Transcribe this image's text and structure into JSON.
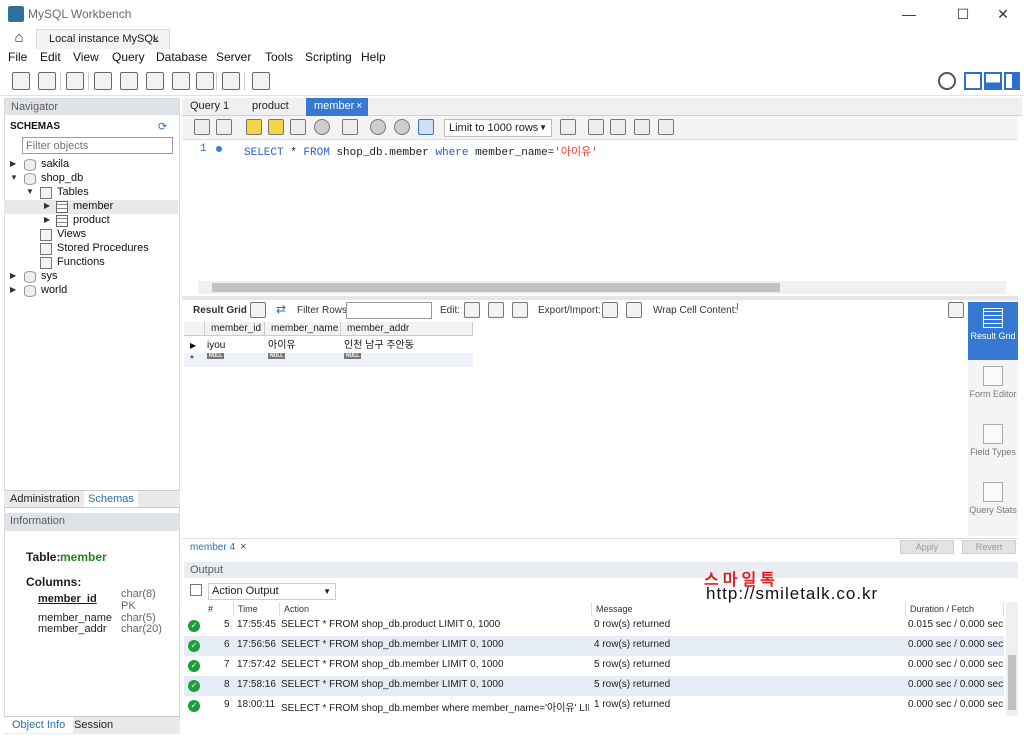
{
  "window": {
    "title": "MySQL Workbench",
    "minimize": "—",
    "maximize": "☐",
    "close": "✕"
  },
  "connection_tab": {
    "label": "Local instance MySQL",
    "close": "×"
  },
  "menu": [
    "File",
    "Edit",
    "View",
    "Query",
    "Database",
    "Server",
    "Tools",
    "Scripting",
    "Help"
  ],
  "navigator": {
    "header": "Navigator",
    "schemas_label": "SCHEMAS",
    "filter_placeholder": "Filter objects",
    "tree": {
      "sakila": "sakila",
      "shop_db": "shop_db",
      "tables": "Tables",
      "member": "member",
      "product": "product",
      "views": "Views",
      "procedures": "Stored Procedures",
      "functions": "Functions",
      "sys": "sys",
      "world": "world"
    },
    "tabs": [
      "Administration",
      "Schemas"
    ]
  },
  "information": {
    "header": "Information",
    "table_label": "Table:",
    "table_name": "member",
    "columns_label": "Columns:",
    "columns": [
      {
        "name": "member_id",
        "type": "char(8)",
        "extra": "PK"
      },
      {
        "name": "member_name",
        "type": "char(5)"
      },
      {
        "name": "member_addr",
        "type": "char(20)"
      }
    ],
    "bottom_tabs": [
      "Object Info",
      "Session"
    ]
  },
  "query_tabs": [
    "Query 1",
    "product",
    "member"
  ],
  "query_tab_close": "×",
  "editor": {
    "limit_label": "Limit to 1000 rows",
    "line_number": "1",
    "sql": {
      "kw1": "SELECT",
      "star": " * ",
      "kw2": "FROM",
      "table": " shop_db.member ",
      "kw3": "where",
      "cond": " member_name=",
      "str": "'아이유'"
    }
  },
  "result_toolbar": {
    "result_grid": "Result Grid",
    "filter_rows": "Filter Rows:",
    "edit": "Edit:",
    "export_import": "Export/Import:",
    "wrap": "Wrap Cell Content:"
  },
  "grid": {
    "columns": [
      "member_id",
      "member_name",
      "member_addr"
    ],
    "row": [
      "iyou",
      "아이유",
      "인천 남구 주안동"
    ],
    "null_text": "NULL"
  },
  "right_sidebar": [
    "Result Grid",
    "Form Editor",
    "Field Types",
    "Query Stats"
  ],
  "result_tab": {
    "label": "member 4",
    "close": "×",
    "apply": "Apply",
    "revert": "Revert"
  },
  "output": {
    "header": "Output",
    "selector": "Action Output",
    "columns": [
      "#",
      "Time",
      "Action",
      "Message",
      "Duration / Fetch"
    ],
    "rows": [
      {
        "n": "5",
        "time": "17:55:45",
        "action": "SELECT * FROM shop_db.product LIMIT 0, 1000",
        "message": "0 row(s) returned",
        "duration": "0.015 sec / 0.000 sec"
      },
      {
        "n": "6",
        "time": "17:56:56",
        "action": "SELECT * FROM shop_db.member LIMIT 0, 1000",
        "message": "4 row(s) returned",
        "duration": "0.000 sec / 0.000 sec"
      },
      {
        "n": "7",
        "time": "17:57:42",
        "action": "SELECT * FROM shop_db.member LIMIT 0, 1000",
        "message": "5 row(s) returned",
        "duration": "0.000 sec / 0.000 sec"
      },
      {
        "n": "8",
        "time": "17:58:16",
        "action": "SELECT * FROM shop_db.member LIMIT 0, 1000",
        "message": "5 row(s) returned",
        "duration": "0.000 sec / 0.000 sec"
      },
      {
        "n": "9",
        "time": "18:00:11",
        "action": "SELECT * FROM shop_db.member where member_name='아이유' LIMIT...",
        "message": "1 row(s) returned",
        "duration": "0.000 sec / 0.000 sec"
      }
    ]
  },
  "watermark": {
    "korean": "스마일톡",
    "url": "http://smiletalk.co.kr"
  },
  "colors": {
    "accent": "#3579d3",
    "ok": "#1aa03a",
    "string": "#e6412a",
    "keyword": "#2c5dcd",
    "watermark_red": "#e02020"
  }
}
